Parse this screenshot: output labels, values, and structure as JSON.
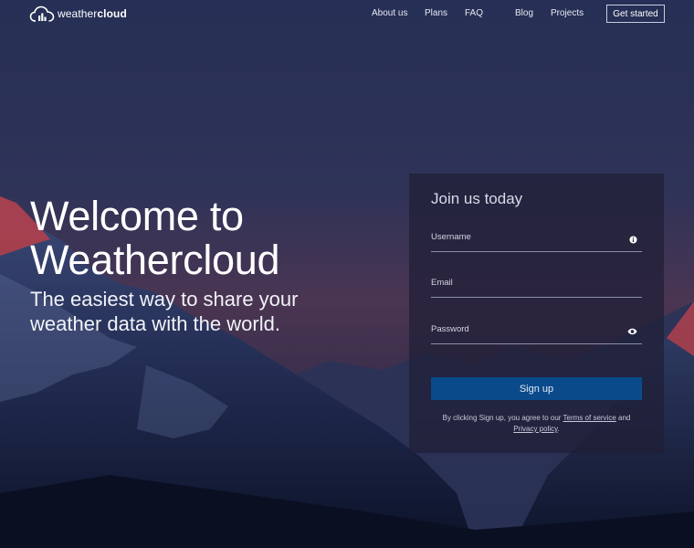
{
  "brand": {
    "name_light": "weather",
    "name_bold": "cloud",
    "icon": "cloud-bar-chart-icon"
  },
  "nav": {
    "items": [
      {
        "label": "About us"
      },
      {
        "label": "Plans"
      },
      {
        "label": "FAQ"
      },
      {
        "label": "Blog"
      },
      {
        "label": "Projects"
      }
    ],
    "cta": "Get started"
  },
  "hero": {
    "title_line1": "Welcome to",
    "title_line2": "Weathercloud",
    "subtitle_line1": "The easiest way to share your",
    "subtitle_line2": "weather data with the world."
  },
  "signup": {
    "title": "Join us today",
    "username_label": "Username",
    "username_icon": "info-icon",
    "email_label": "Email",
    "password_label": "Password",
    "password_icon": "eye-icon",
    "button": "Sign up",
    "legal_prefix": "By clicking Sign up, you agree to our",
    "terms_link": "Terms of service",
    "legal_and": "and",
    "privacy_link": "Privacy policy",
    "legal_suffix": "."
  },
  "colors": {
    "accent": "#0b4a8a",
    "panel": "#201f36"
  }
}
